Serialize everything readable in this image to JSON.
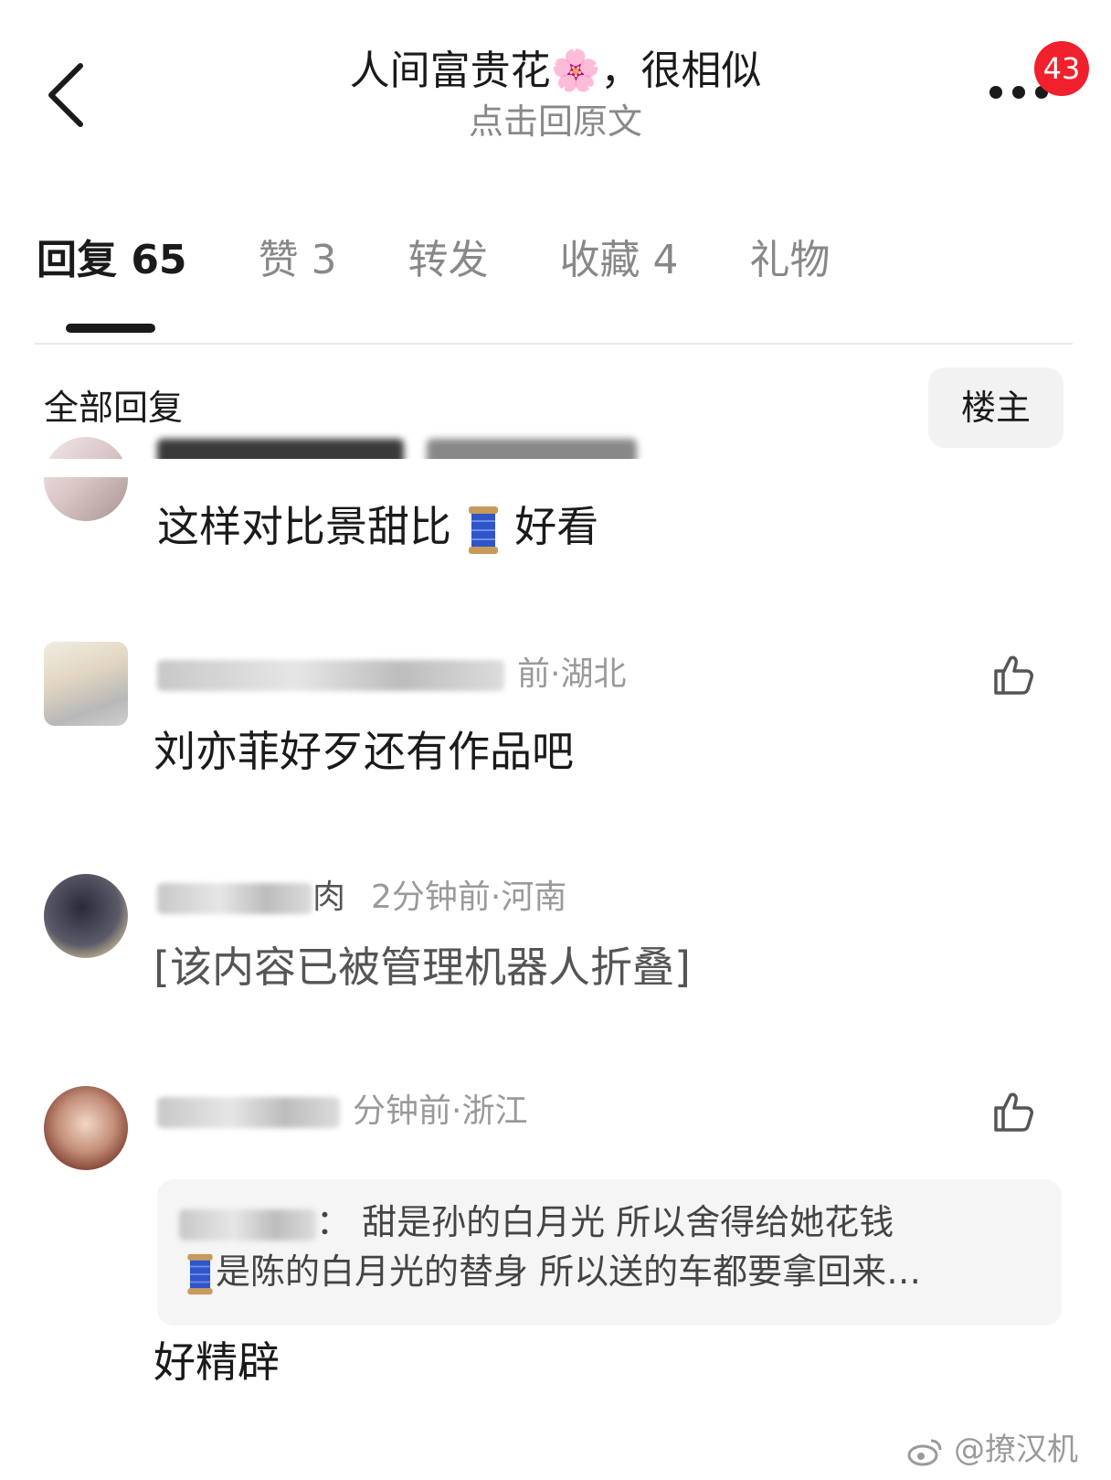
{
  "header": {
    "title": "人间富贵花🌸，很相似",
    "subtitle": "点击回原文",
    "badge_count": "43"
  },
  "tabs": [
    {
      "label": "回复 65"
    },
    {
      "label": "赞 3"
    },
    {
      "label": "转发"
    },
    {
      "label": "收藏 4"
    },
    {
      "label": "礼物"
    }
  ],
  "filter": {
    "label": "全部回复",
    "op_button": "楼主"
  },
  "comments": [
    {
      "meta": "",
      "text_before": "这样对比景甜比",
      "text_after": "好看"
    },
    {
      "meta": "前·湖北",
      "text": "刘亦菲好歹还有作品吧"
    },
    {
      "name_tail": "肉",
      "meta": "2分钟前·河南",
      "text": "[该内容已被管理机器人折叠]"
    },
    {
      "meta": "分钟前·浙江",
      "quote_prefix": "：",
      "quote_line1": "甜是孙的白月光 所以舍得给她花钱",
      "quote_line2": "是陈的白月光的替身 所以送的车都要拿回来…",
      "text": "好精辟"
    }
  ],
  "watermark": "@撩汉机",
  "colors": {
    "badge": "#f0202c",
    "accent_text": "#1a1a1a",
    "muted": "#9a9a9a"
  }
}
